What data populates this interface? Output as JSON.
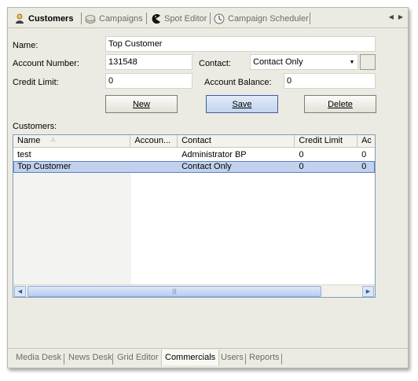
{
  "tabs": [
    {
      "label": "Customers",
      "icon": "person-icon",
      "active": true
    },
    {
      "label": "Campaigns",
      "icon": "coins-icon",
      "active": false
    },
    {
      "label": "Spot Editor",
      "icon": "pacman-icon",
      "active": false
    },
    {
      "label": "Campaign Scheduler",
      "icon": "clock-icon",
      "active": false
    }
  ],
  "form": {
    "name_label": "Name:",
    "name_value": "Top Customer",
    "account_label": "Account Number:",
    "account_value": "131548",
    "contact_label": "Contact:",
    "contact_value": "Contact Only",
    "credit_label": "Credit Limit:",
    "credit_value": "0",
    "balance_label": "Account Balance:",
    "balance_value": "0"
  },
  "buttons": {
    "new": "New",
    "save": "Save",
    "delete": "Delete"
  },
  "customers": {
    "label": "Customers:",
    "columns": [
      "Name",
      "Accoun...",
      "Contact",
      "Credit Limit",
      "Ac"
    ],
    "rows": [
      {
        "name": "test",
        "account": "",
        "contact": "Administrator BP",
        "credit": "0",
        "ac": "0",
        "selected": false
      },
      {
        "name": "Top Customer",
        "account": "",
        "contact": "Contact Only",
        "credit": "0",
        "ac": "0",
        "selected": true
      }
    ]
  },
  "bottom_tabs": [
    {
      "label": "Media Desk",
      "active": false
    },
    {
      "label": "News Desk",
      "active": false
    },
    {
      "label": "Grid Editor",
      "active": false
    },
    {
      "label": "Commercials",
      "active": true
    },
    {
      "label": "Users",
      "active": false
    },
    {
      "label": "Reports",
      "active": false
    }
  ],
  "colors": {
    "selection": "#c2d2ee",
    "window_bg": "#ecebe3",
    "primary_button": "#c2d4ef"
  }
}
